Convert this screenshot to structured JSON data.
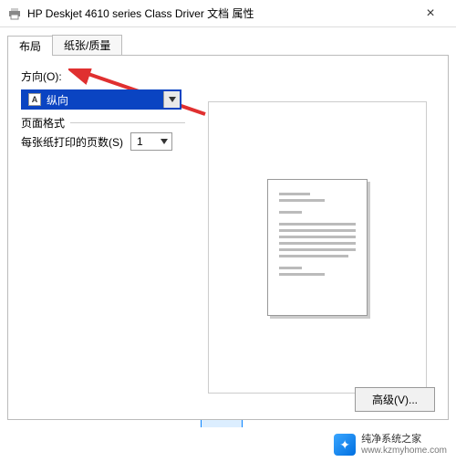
{
  "titlebar": {
    "title": "HP Deskjet 4610 series Class Driver 文档 属性",
    "close": "×"
  },
  "tabs": {
    "layout": "布局",
    "paper_quality": "纸张/质量"
  },
  "orientation": {
    "label": "方向(O):",
    "doc_glyph": "A",
    "value": "纵向"
  },
  "page_format": {
    "title": "页面格式",
    "pages_per_sheet_label": "每张纸打印的页数(S)",
    "pages_per_sheet_value": "1"
  },
  "buttons": {
    "advanced": "高级(V)..."
  },
  "watermark": {
    "brand": "纯净系统之家",
    "url": "www.kzmyhome.com"
  }
}
